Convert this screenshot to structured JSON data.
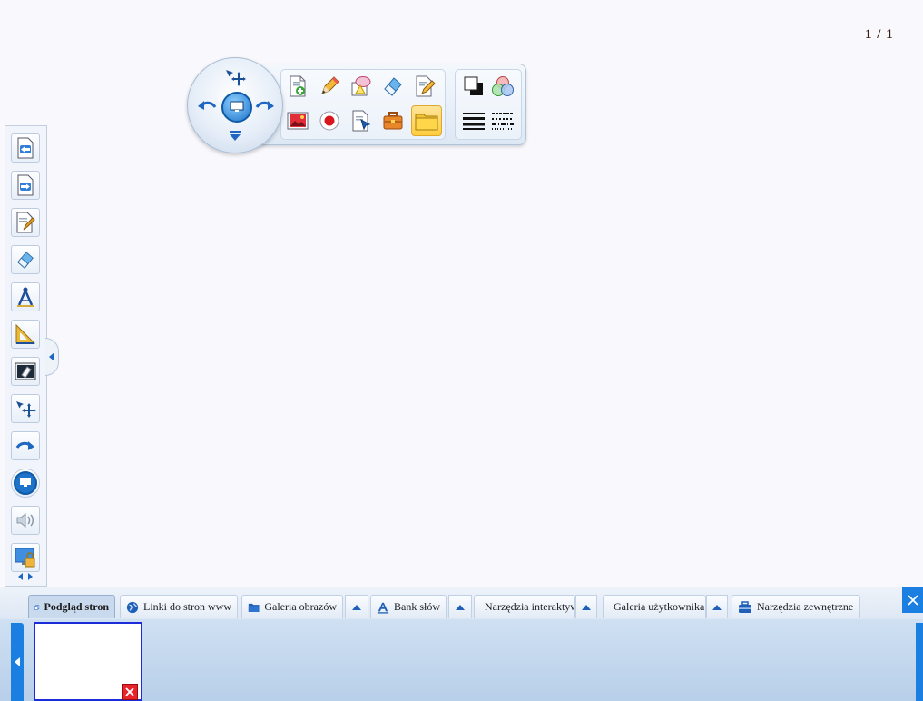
{
  "page_counter": "1 / 1",
  "floating_toolbar": {
    "wheel": {
      "center_icon": "screen-icon",
      "top_icon": "select-move-icon",
      "left_icon": "arrow-left-icon",
      "right_icon": "arrow-right-icon",
      "bottom_icon": "collapse-down-icon"
    },
    "tools_row1": [
      "new-page-icon",
      "pencil-icon",
      "shape-icon",
      "eraser-icon",
      "edit-page-icon"
    ],
    "tools_row2": [
      "image-icon",
      "record-icon",
      "page-select-icon",
      "toolbox-icon",
      "folder-icon"
    ],
    "style_row1": [
      "fill-color-icon",
      "color-mix-icon"
    ],
    "style_row2": [
      "line-weight-icon",
      "line-style-icon"
    ],
    "active_tool": "folder-icon"
  },
  "left_sidebar": {
    "items": [
      "previous-page-icon",
      "next-page-icon",
      "clear-page-icon",
      "eraser-icon",
      "compass-icon",
      "set-square-icon",
      "screen-shade-icon",
      "select-move-icon",
      "arrow-right-icon",
      "screen-icon",
      "speaker-icon",
      "lock-screen-icon"
    ]
  },
  "bottom_panel": {
    "tabs": [
      {
        "label": "Podgląd stron",
        "icon": "pages-icon",
        "active": true
      },
      {
        "label": "Linki do stron www",
        "icon": "globe-icon",
        "active": false
      },
      {
        "label": "Galeria obrazów",
        "icon": "folder-icon",
        "active": false
      },
      {
        "label": "Bank słów",
        "icon": "letter-a-icon",
        "active": false
      },
      {
        "label": "Narzędzia interaktywne",
        "icon": "interactive-tools-icon",
        "active": false
      },
      {
        "label": "Galeria użytkownika",
        "icon": "user-folder-icon",
        "active": false
      },
      {
        "label": "Narzędzia zewnętrzne",
        "icon": "toolbox-icon",
        "active": false
      }
    ],
    "accent_color": "#1a7fe0"
  }
}
